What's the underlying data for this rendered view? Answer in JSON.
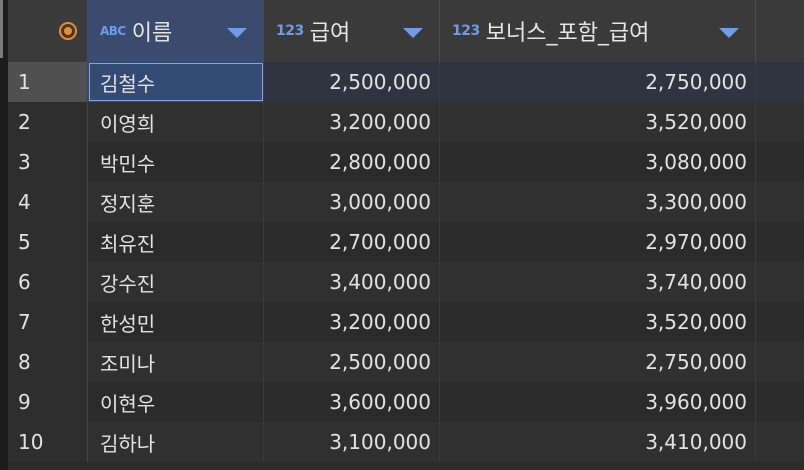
{
  "header": {
    "columns": [
      {
        "type": "ABC",
        "label": "이름"
      },
      {
        "type": "123",
        "label": "급여"
      },
      {
        "type": "123",
        "label": "보너스_포함_급여"
      }
    ]
  },
  "rows": [
    {
      "n": "1",
      "name": "김철수",
      "salary": "2,500,000",
      "bonus": "2,750,000"
    },
    {
      "n": "2",
      "name": "이영희",
      "salary": "3,200,000",
      "bonus": "3,520,000"
    },
    {
      "n": "3",
      "name": "박민수",
      "salary": "2,800,000",
      "bonus": "3,080,000"
    },
    {
      "n": "4",
      "name": "정지훈",
      "salary": "3,000,000",
      "bonus": "3,300,000"
    },
    {
      "n": "5",
      "name": "최유진",
      "salary": "2,700,000",
      "bonus": "2,970,000"
    },
    {
      "n": "6",
      "name": "강수진",
      "salary": "3,400,000",
      "bonus": "3,740,000"
    },
    {
      "n": "7",
      "name": "한성민",
      "salary": "3,200,000",
      "bonus": "3,520,000"
    },
    {
      "n": "8",
      "name": "조미나",
      "salary": "2,500,000",
      "bonus": "2,750,000"
    },
    {
      "n": "9",
      "name": "이현우",
      "salary": "3,600,000",
      "bonus": "3,960,000"
    },
    {
      "n": "10",
      "name": "김하나",
      "salary": "3,100,000",
      "bonus": "3,410,000"
    }
  ],
  "colors": {
    "accent": "#6f9be8",
    "corner": "#f08c2a",
    "selected_cell": "#324a74"
  }
}
